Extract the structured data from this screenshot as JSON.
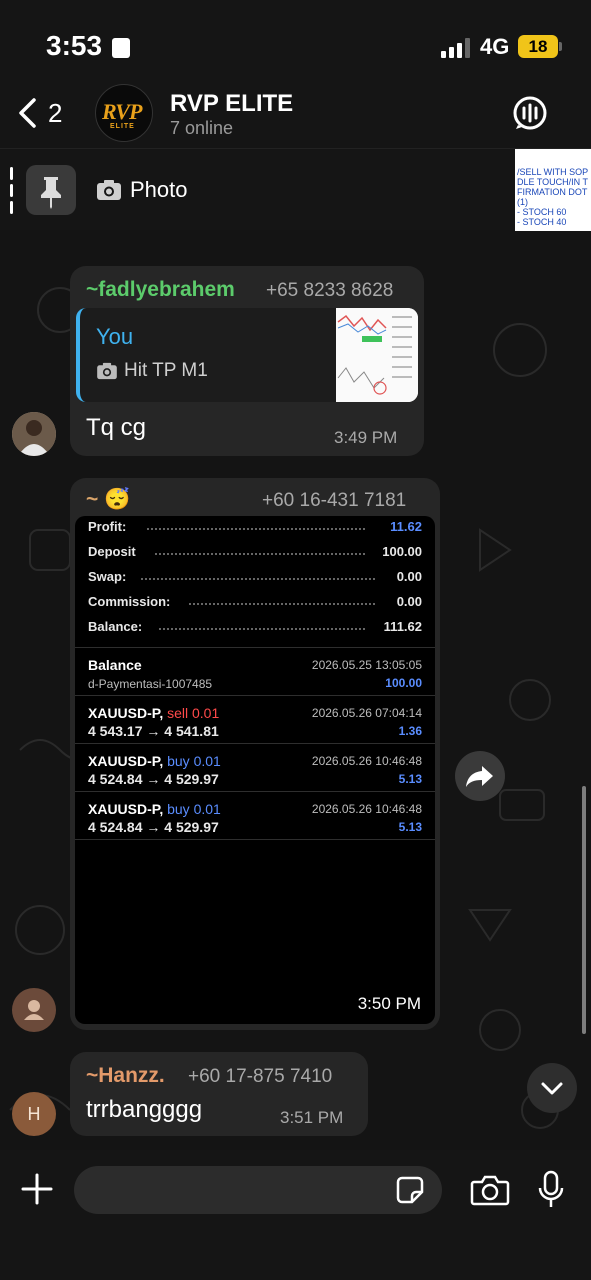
{
  "status_bar": {
    "time": "3:53",
    "network": "4G",
    "battery": "18"
  },
  "header": {
    "back_count": "2",
    "group_name": "RVP ELITE",
    "group_status": "7 online",
    "avatar_logo": "RVP",
    "avatar_sub": "ELITE"
  },
  "pinned": {
    "label": "Photo",
    "thumb_lines": [
      "/SELL WITH SOP",
      "DLE TOUCH/IN T",
      "FIRMATION DOT",
      "(1)",
      "- STOCH 60",
      "- STOCH 40"
    ]
  },
  "messages": [
    {
      "sender": "~fadlyebrahem",
      "phone": "+65 8233 8628",
      "reply_to": {
        "who": "You",
        "text": "Hit TP M1"
      },
      "text": "Tq cg",
      "time": "3:49 PM",
      "sender_color": "#5ccb6b"
    },
    {
      "sender": "~ 😴",
      "phone": "+60 16-431 7181",
      "time": "3:50 PM",
      "report": {
        "summary": [
          {
            "label": "Profit:",
            "value": "11.62",
            "value_color": "#5a8dff"
          },
          {
            "label": "Deposit",
            "value": "100.00"
          },
          {
            "label": "Swap:",
            "value": "0.00"
          },
          {
            "label": "Commission:",
            "value": "0.00"
          },
          {
            "label": "Balance:",
            "value": "111.62"
          }
        ],
        "balance_entry": {
          "title": "Balance",
          "sub": "d-Paymentasi-1007485",
          "date": "2026.05.25 13:05:05",
          "amount": "100.00"
        },
        "deals": [
          {
            "symbol": "XAUUSD-P,",
            "side": "sell",
            "lot": "0.01",
            "prices": "4 543.17 → 4 541.81",
            "date": "2026.05.26 07:04:14",
            "pl": "1.36"
          },
          {
            "symbol": "XAUUSD-P,",
            "side": "buy",
            "lot": "0.01",
            "prices": "4 524.84 → 4 529.97",
            "date": "2026.05.26 10:46:48",
            "pl": "5.13"
          },
          {
            "symbol": "XAUUSD-P,",
            "side": "buy",
            "lot": "0.01",
            "prices": "4 524.84 → 4 529.97",
            "date": "2026.05.26 10:46:48",
            "pl": "5.13"
          }
        ]
      }
    },
    {
      "sender": "~Hanzz.",
      "phone": "+60 17-875 7410",
      "text": "trrbangggg",
      "time": "3:51 PM",
      "avatar_letter": "H",
      "sender_color": "#e39a6a"
    }
  ],
  "icons": [
    "back-chevron-icon",
    "call-icon",
    "pin-icon",
    "camera-icon",
    "forward-icon",
    "chevron-down-icon",
    "plus-icon",
    "sticker-icon",
    "mic-icon"
  ]
}
